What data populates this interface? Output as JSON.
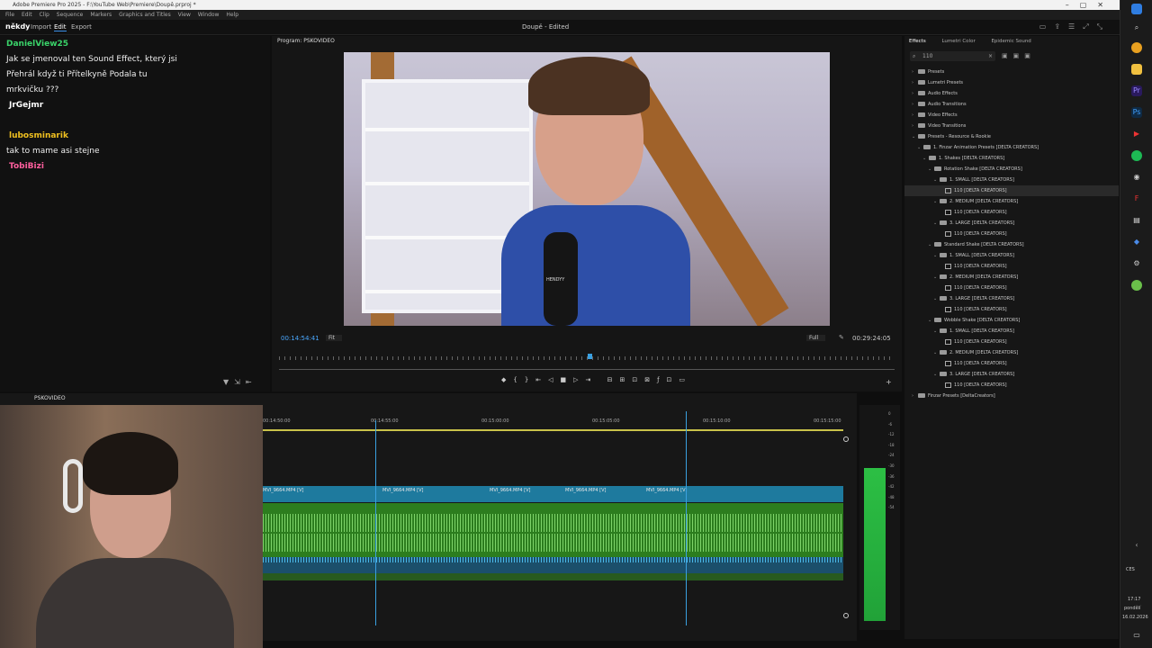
{
  "window": {
    "title": "Adobe Premiere Pro 2025 - F:\\YouTube Web\\Premiere\\Doupě.prproj *"
  },
  "menu": [
    "File",
    "Edit",
    "Clip",
    "Sequence",
    "Markers",
    "Graphics and Titles",
    "View",
    "Window",
    "Help"
  ],
  "header": {
    "ws_import": "Import",
    "ws_edit": "Edit",
    "ws_export": "Export",
    "title": "Doupě - Edited",
    "overlay_name": "někdy"
  },
  "chat": {
    "messages": [
      {
        "user": "DanielView25",
        "text": "Jak se jmenoval ten Sound Effect, který jsi Přehrál když ti Přítelkyně Podala tu mrkvičku ???",
        "color": "#3ad46a"
      },
      {
        "user": "JrGejmr",
        "text": "",
        "color": "#ffffff"
      },
      {
        "user": "lubosminarik",
        "text": "tak to mame asi stejne",
        "color": "#f0c020"
      },
      {
        "user": "TobiBizi",
        "text": "",
        "color": "#ff5f9e"
      }
    ]
  },
  "program": {
    "tab": "Program: PSKOVIDEO",
    "timecode": "00:14:54:41",
    "fit": "Fit",
    "quality": "Full",
    "duration": "00:29:24:05",
    "mic_brand": "HENDYY"
  },
  "timeline": {
    "tab": "PSKOVIDEO",
    "ticks": [
      "00:14:50:00",
      "00:14:55:00",
      "00:15:00:00",
      "00:15:05:00",
      "00:15:10:00",
      "00:15:15:00"
    ],
    "clips": [
      "MVI_9664.MP4 [V]",
      "MVI_9664.MP4 [V]",
      "MVI_9664.MP4 [V]",
      "MVI_9664.MP4 [V]",
      "MVI_9664.MP4 [V]"
    ]
  },
  "effects": {
    "tabs": [
      "Effects",
      "Lumetri Color",
      "Epidemic Sound"
    ],
    "search": "110",
    "tree": [
      {
        "label": "Presets",
        "level": 0,
        "type": "folder",
        "open": false
      },
      {
        "label": "Lumetri Presets",
        "level": 0,
        "type": "folder",
        "open": false
      },
      {
        "label": "Audio Effects",
        "level": 0,
        "type": "folder",
        "open": false
      },
      {
        "label": "Audio Transitions",
        "level": 0,
        "type": "folder",
        "open": false
      },
      {
        "label": "Video Effects",
        "level": 0,
        "type": "folder",
        "open": false
      },
      {
        "label": "Video Transitions",
        "level": 0,
        "type": "folder",
        "open": false
      },
      {
        "label": "Presets - Resource & Rookie",
        "level": 0,
        "type": "folder",
        "open": true
      },
      {
        "label": "1. Finzar Animation Presets [DELTA CREATORS]",
        "level": 1,
        "type": "folder",
        "open": true
      },
      {
        "label": "1. Shakes [DELTA CREATORS]",
        "level": 2,
        "type": "folder",
        "open": true
      },
      {
        "label": "Rotation Shake [DELTA CREATORS]",
        "level": 3,
        "type": "folder",
        "open": true
      },
      {
        "label": "1. SMALL [DELTA CREATORS]",
        "level": 4,
        "type": "folder",
        "open": true
      },
      {
        "label": "110 [DELTA CREATORS]",
        "level": 5,
        "type": "fx",
        "sel": true
      },
      {
        "label": "2. MEDIUM [DELTA CREATORS]",
        "level": 4,
        "type": "folder",
        "open": true
      },
      {
        "label": "110 [DELTA CREATORS]",
        "level": 5,
        "type": "fx"
      },
      {
        "label": "3. LARGE [DELTA CREATORS]",
        "level": 4,
        "type": "folder",
        "open": true
      },
      {
        "label": "110 [DELTA CREATORS]",
        "level": 5,
        "type": "fx"
      },
      {
        "label": "Standard Shake [DELTA CREATORS]",
        "level": 3,
        "type": "folder",
        "open": true
      },
      {
        "label": "1. SMALL [DELTA CREATORS]",
        "level": 4,
        "type": "folder",
        "open": true
      },
      {
        "label": "110 [DELTA CREATORS]",
        "level": 5,
        "type": "fx"
      },
      {
        "label": "2. MEDIUM [DELTA CREATORS]",
        "level": 4,
        "type": "folder",
        "open": true
      },
      {
        "label": "110 [DELTA CREATORS]",
        "level": 5,
        "type": "fx"
      },
      {
        "label": "3. LARGE [DELTA CREATORS]",
        "level": 4,
        "type": "folder",
        "open": true
      },
      {
        "label": "110 [DELTA CREATORS]",
        "level": 5,
        "type": "fx"
      },
      {
        "label": "Wobble Shake [DELTA CREATORS]",
        "level": 3,
        "type": "folder",
        "open": true
      },
      {
        "label": "1. SMALL [DELTA CREATORS]",
        "level": 4,
        "type": "folder",
        "open": true
      },
      {
        "label": "110 [DELTA CREATORS]",
        "level": 5,
        "type": "fx"
      },
      {
        "label": "2. MEDIUM [DELTA CREATORS]",
        "level": 4,
        "type": "folder",
        "open": true
      },
      {
        "label": "110 [DELTA CREATORS]",
        "level": 5,
        "type": "fx"
      },
      {
        "label": "3. LARGE [DELTA CREATORS]",
        "level": 4,
        "type": "folder",
        "open": true
      },
      {
        "label": "110 [DELTA CREATORS]",
        "level": 5,
        "type": "fx"
      },
      {
        "label": "Finzar Presets [DeltaCreators]",
        "level": 0,
        "type": "folder",
        "open": false
      }
    ]
  },
  "meter_ticks": [
    "0",
    "-6",
    "-12",
    "-18",
    "-24",
    "-30",
    "-36",
    "-42",
    "-48",
    "-54"
  ],
  "taskbar": {
    "lang": "CES",
    "time": "17:17",
    "day": "pondělí",
    "date": "16.02.2026"
  }
}
